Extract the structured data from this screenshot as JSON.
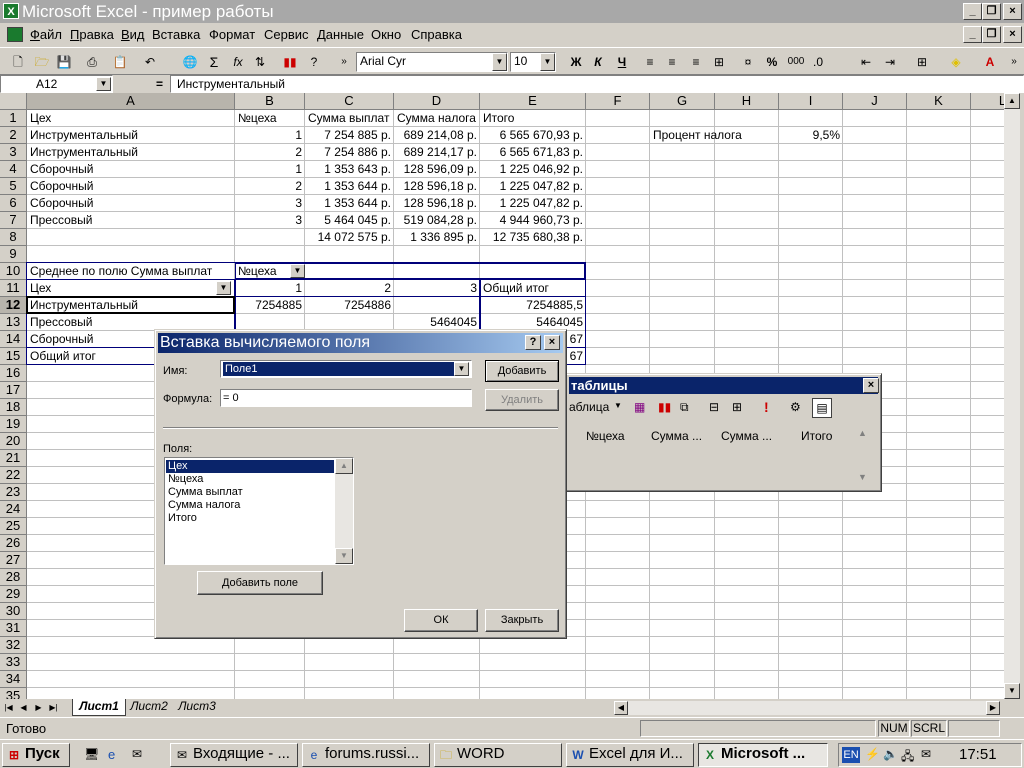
{
  "window": {
    "title": "Microsoft Excel - пример работы",
    "app_icon": "excel-icon"
  },
  "menu": [
    {
      "label": "Файл",
      "u": "Ф",
      "rest": "айл"
    },
    {
      "label": "Правка",
      "u": "П",
      "rest": "равка"
    },
    {
      "label": "Вид",
      "u": "В",
      "rest": "ид"
    },
    {
      "label": "Вставка",
      "u": "",
      "rest": "Вставка"
    },
    {
      "label": "Формат",
      "u": "",
      "rest": "Формат"
    },
    {
      "label": "Сервис",
      "u": "",
      "rest": "Сервис"
    },
    {
      "label": "Данные",
      "u": "",
      "rest": "Данные"
    },
    {
      "label": "Окно",
      "u": "",
      "rest": "Окно"
    },
    {
      "label": "Справка",
      "u": "",
      "rest": "Справка"
    }
  ],
  "toolbar": {
    "font": "Arial Cyr",
    "size": "10",
    "bold": "Ж",
    "italic": "К",
    "underline": "Ч",
    "percent": "%",
    "thousands": "000"
  },
  "formula_bar": {
    "name_box": "A12",
    "equals": "=",
    "content": "Инструментальный"
  },
  "columns": [
    "A",
    "B",
    "C",
    "D",
    "E",
    "F",
    "G",
    "H",
    "I",
    "J",
    "K",
    "L"
  ],
  "rows": [
    "1",
    "2",
    "3",
    "4",
    "5",
    "6",
    "7",
    "8",
    "9",
    "10",
    "11",
    "12",
    "13",
    "14",
    "15",
    "16",
    "17",
    "18",
    "19",
    "20",
    "21",
    "22",
    "23",
    "24",
    "25",
    "26",
    "27",
    "28",
    "29",
    "30",
    "31",
    "32",
    "33",
    "34",
    "35"
  ],
  "cells": {
    "a1": "Цех",
    "b1": "№цеха",
    "c1": "Сумма выплат",
    "d1": "Сумма налога",
    "e1": "Итого",
    "a2": "Инструментальный",
    "b2": "1",
    "c2": "7 254 885 р.",
    "d2": "689 214,08 р.",
    "e2": "6 565 670,93 р.",
    "g2": "Процент налога",
    "i2": "9,5%",
    "a3": "Инструментальный",
    "b3": "2",
    "c3": "7 254 886 р.",
    "d3": "689 214,17 р.",
    "e3": "6 565 671,83 р.",
    "a4": "Сборочный",
    "b4": "1",
    "c4": "1 353 643 р.",
    "d4": "128 596,09 р.",
    "e4": "1 225 046,92 р.",
    "a5": "Сборочный",
    "b5": "2",
    "c5": "1 353 644 р.",
    "d5": "128 596,18 р.",
    "e5": "1 225 047,82 р.",
    "a6": "Сборочный",
    "b6": "3",
    "c6": "1 353 644 р.",
    "d6": "128 596,18 р.",
    "e6": "1 225 047,82 р.",
    "a7": "Прессовый",
    "b7": "3",
    "c7": "5 464 045 р.",
    "d7": "519 084,28 р.",
    "e7": "4 944 960,73 р.",
    "c8": "14 072 575 р.",
    "d8": "1 336 895 р.",
    "e8": "12 735 680,38 р.",
    "a10": "Среднее по полю Сумма выплат",
    "b10": "№цеха",
    "a11": "Цех",
    "b11": "1",
    "c11": "2",
    "d11": "3",
    "e11": "Общий итог",
    "a12": "Инструментальный",
    "b12": "7254885",
    "c12": "7254886",
    "e12": "7254885,5",
    "a13": "Прессовый",
    "d13": "5464045",
    "e13": "5464045",
    "a14": "Сборочный",
    "e14": "67",
    "a15": "Общий итог",
    "e15": "67"
  },
  "sheets": [
    "Лист1",
    "Лист2",
    "Лист3"
  ],
  "status": {
    "ready": "Готово",
    "num": "NUM",
    "scrl": "SCRL"
  },
  "dialog": {
    "title": "Вставка вычисляемого поля",
    "help": "?",
    "name_label": "Имя:",
    "name_value": "Поле1",
    "formula_label": "Формула:",
    "formula_value": "= 0",
    "add_button": "Добавить",
    "delete_button": "Удалить",
    "fields_label": "Поля:",
    "fields": [
      "Цех",
      "№цеха",
      "Сумма выплат",
      "Сумма налога",
      "Итого"
    ],
    "insert_field_button": "Добавить поле",
    "ok_button": "ОК",
    "close_button": "Закрыть"
  },
  "pivot_toolbar": {
    "title": "таблицы",
    "menu_label": "аблица",
    "fields": [
      "№цеха",
      "Сумма ...",
      "Сумма ...",
      "Итого"
    ]
  },
  "taskbar": {
    "start": "Пуск",
    "items": [
      "Входящие - ...",
      "forums.russi...",
      "WORD",
      "Excel для И...",
      "Microsoft ..."
    ],
    "lang": "EN",
    "time": "17:51"
  }
}
